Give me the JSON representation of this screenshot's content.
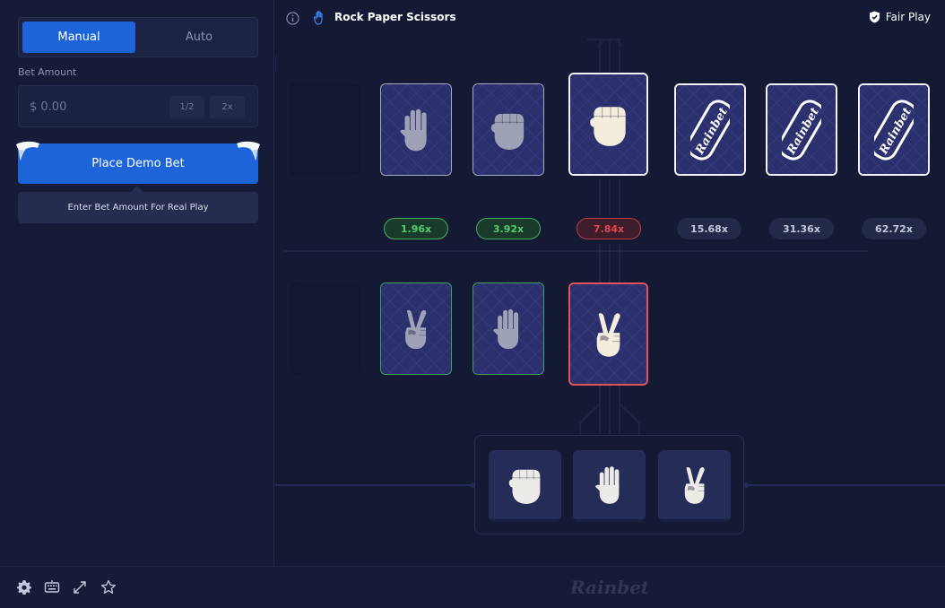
{
  "sidebar": {
    "mode_tabs": [
      {
        "label": "Manual",
        "active": true
      },
      {
        "label": "Auto",
        "active": false
      }
    ],
    "bet_amount_label": "Bet Amount",
    "bet_placeholder": "$ 0.00",
    "half_label": "1/2",
    "double_label": "2x",
    "place_bet_label": "Place Demo Bet",
    "real_play_tip": "Enter Bet Amount For Real Play"
  },
  "header": {
    "title": "Rock Paper Scissors",
    "fair_play_label": "Fair Play"
  },
  "board": {
    "dealer_row": [
      {
        "state": "revealed",
        "hand": "paper"
      },
      {
        "state": "revealed",
        "hand": "rock"
      },
      {
        "state": "current",
        "hand": "rock"
      },
      {
        "state": "hidden",
        "logo": "Rainbet"
      },
      {
        "state": "hidden",
        "logo": "Rainbet"
      },
      {
        "state": "hidden",
        "logo": "Rainbet"
      }
    ],
    "multipliers": [
      {
        "label": "1.96x",
        "status": "won"
      },
      {
        "label": "3.92x",
        "status": "won"
      },
      {
        "label": "7.84x",
        "status": "lost"
      },
      {
        "label": "15.68x",
        "status": "pending"
      },
      {
        "label": "31.36x",
        "status": "pending"
      },
      {
        "label": "62.72x",
        "status": "pending"
      }
    ],
    "player_row": [
      {
        "hand": "scissors",
        "result": "win"
      },
      {
        "hand": "paper",
        "result": "win"
      },
      {
        "hand": "scissors",
        "result": "lose"
      }
    ],
    "picker_options": [
      "rock",
      "paper",
      "scissors"
    ]
  },
  "footer": {
    "icons": [
      "settings-icon",
      "keyboard-icon",
      "fullscreen-icon",
      "star-icon"
    ],
    "brand": "Rainbet"
  },
  "colors": {
    "accent": "#1d64d8",
    "win": "#3fae5a",
    "lose": "#e2545a",
    "background": "#141a33"
  }
}
